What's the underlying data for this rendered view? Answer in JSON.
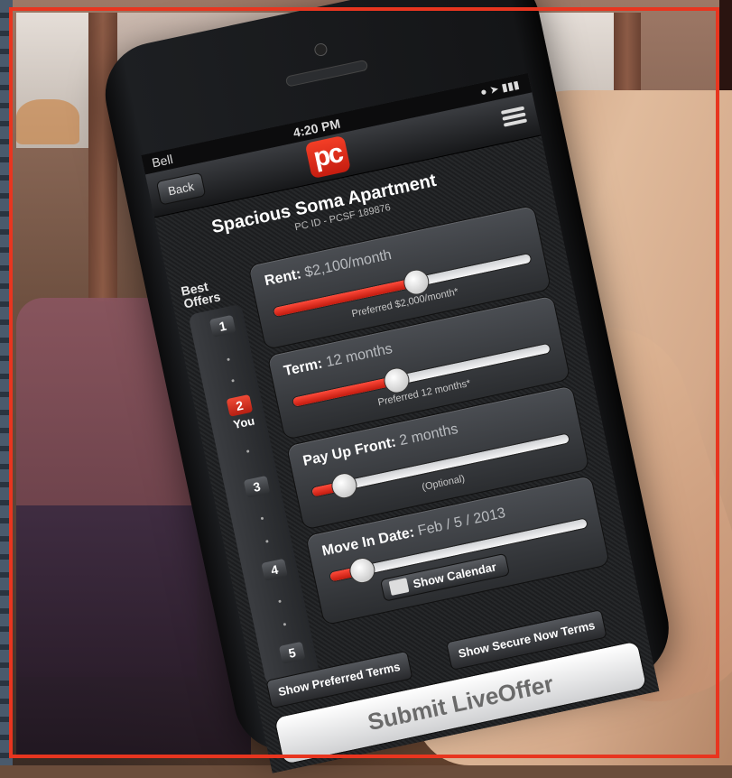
{
  "status": {
    "carrier": "Bell",
    "time": "4:20 PM"
  },
  "nav": {
    "back_label": "Back",
    "logo_text": "pc"
  },
  "listing": {
    "title": "Spacious Soma Apartment",
    "id_text": "PC ID - PCSF 189876"
  },
  "offers": {
    "heading_line1": "Best",
    "heading_line2": "Offers",
    "items": [
      "1",
      "2",
      "3",
      "4",
      "5"
    ],
    "you_label": "You",
    "current_rank": 2
  },
  "sliders": [
    {
      "label": "Rent:",
      "value": "$2,100/month",
      "hint": "Preferred $2,000/month*",
      "fill": 0.55
    },
    {
      "label": "Term:",
      "value": "12 months",
      "hint": "Preferred 12 months*",
      "fill": 0.4
    },
    {
      "label": "Pay Up Front:",
      "value": "2 months",
      "hint": "(Optional)",
      "fill": 0.12
    },
    {
      "label": "Move In Date:",
      "value": "Feb / 5 / 2013",
      "hint": "",
      "fill": 0.12
    }
  ],
  "calendar_button": "Show Calendar",
  "buttons": {
    "preferred_terms": "Show Preferred Terms",
    "secure_now_terms": "Show Secure Now Terms",
    "submit": "Submit LiveOffer"
  },
  "colors": {
    "accent": "#e8351f",
    "slider_fill": "#d9261a"
  }
}
